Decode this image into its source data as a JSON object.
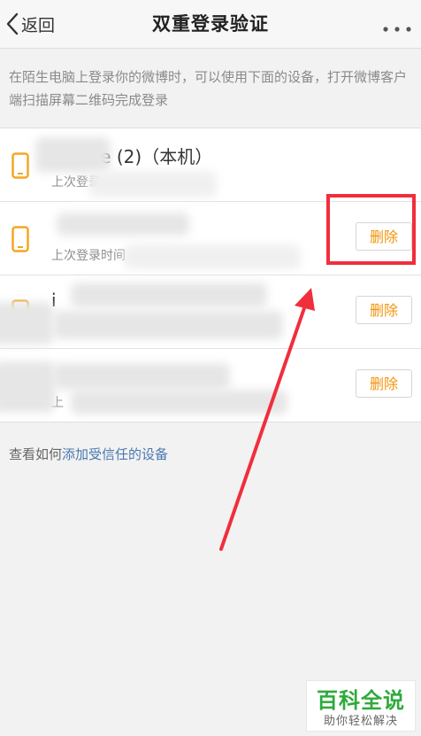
{
  "nav": {
    "back_label": "返回",
    "title": "双重登录验证",
    "more_icon": "more-dots-icon"
  },
  "intro": "在陌生电脑上登录你的微博时，可以使用下面的设备，打开微博客户端扫描屏幕二维码完成登录",
  "devices": [
    {
      "name": "iPhone (2)（本机）",
      "sub": "上次登录",
      "icon": "phone-icon"
    },
    {
      "name": "",
      "sub": "上次登录时间",
      "delete_label": "删除",
      "icon": "phone-icon"
    },
    {
      "name": "i",
      "sub": "",
      "delete_label": "删除",
      "icon": "phone-icon"
    },
    {
      "name": "",
      "sub": "上",
      "delete_label": "删除",
      "icon": "phone-icon"
    }
  ],
  "footer": {
    "prefix": "查看如何",
    "link": "添加受信任的设备"
  },
  "watermark": {
    "main": "百科全说",
    "sub": "助你轻松解决"
  },
  "colors": {
    "accent_orange": "#f2940a",
    "highlight_red": "#f12e3c",
    "link_blue": "#4a78b0",
    "watermark_green": "#2eaa3c"
  }
}
